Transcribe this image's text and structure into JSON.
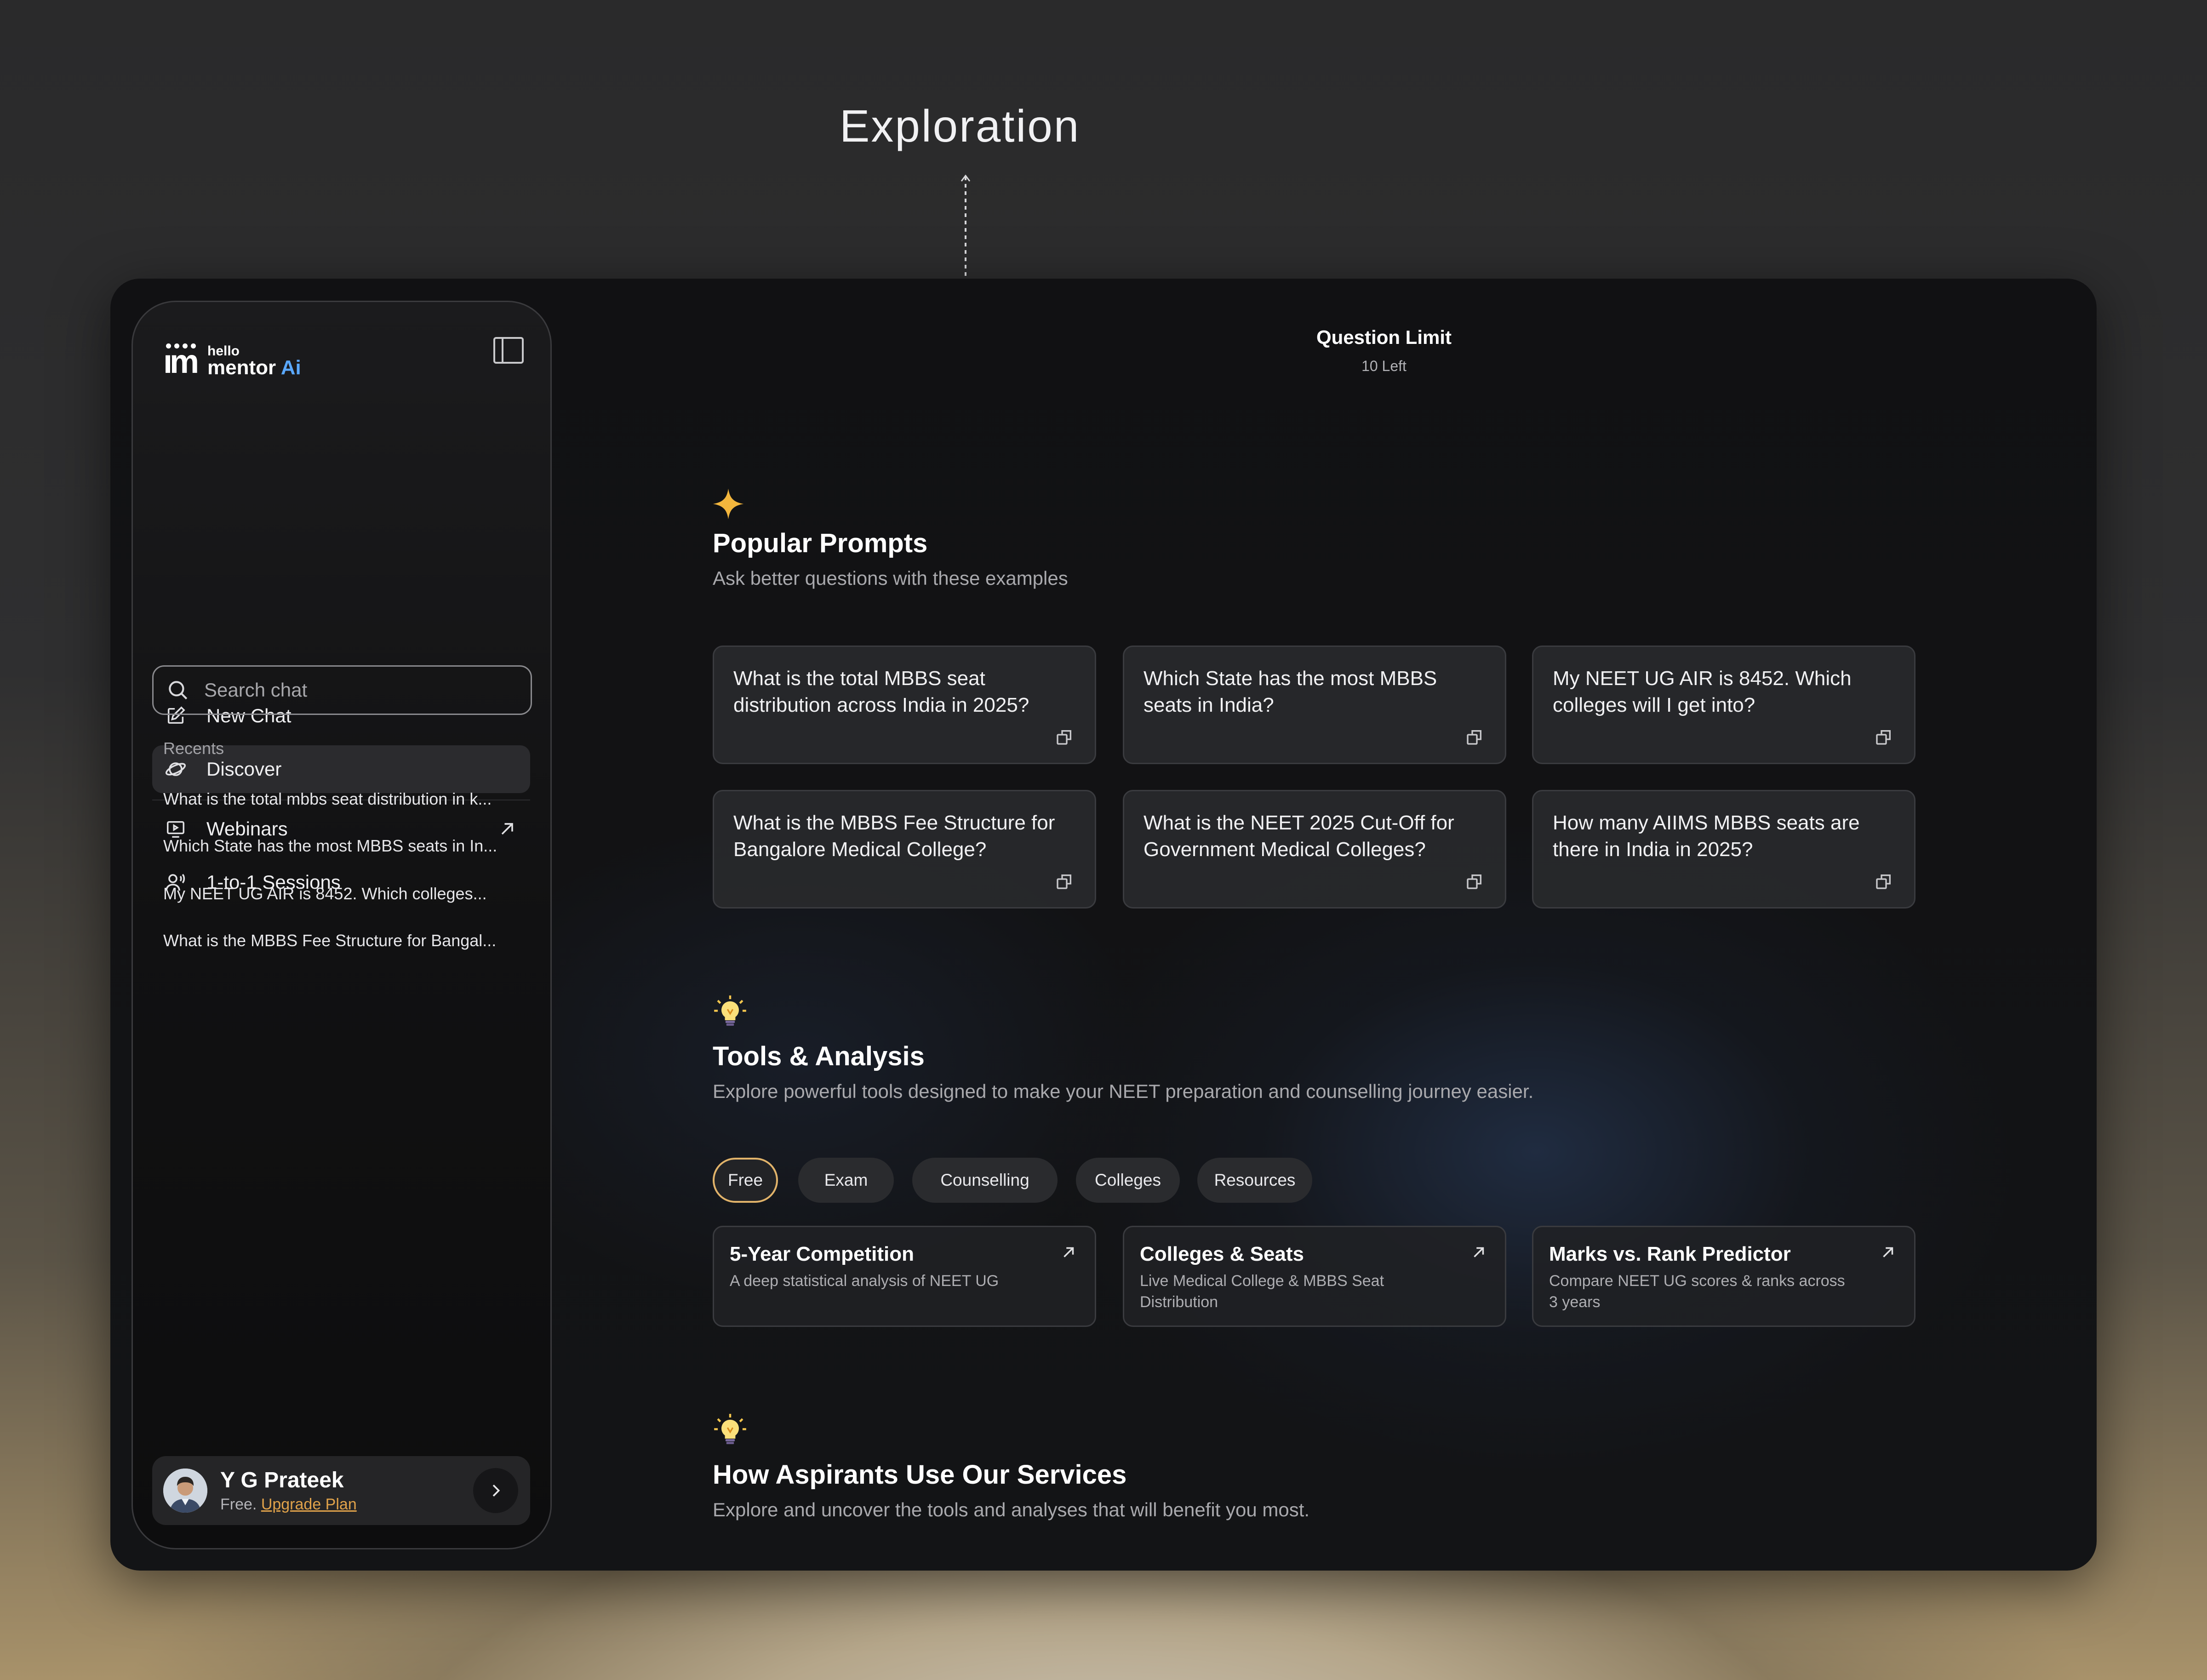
{
  "annotation": {
    "title": "Exploration"
  },
  "sidebar": {
    "logo": {
      "hello": "hello",
      "mentor": "mentor",
      "ai": "Ai"
    },
    "nav": [
      {
        "label": "New Chat",
        "icon": "edit-icon"
      },
      {
        "label": "Discover",
        "icon": "planet-icon",
        "active": true
      },
      {
        "label": "Webinars",
        "icon": "video-icon",
        "external": true
      },
      {
        "label": "1-to-1 Sessions",
        "icon": "voice-user-icon"
      }
    ],
    "search": {
      "placeholder": "Search chat"
    },
    "recents_label": "Recents",
    "recents": [
      "What is the total mbbs seat distribution in k...",
      "Which State has the most MBBS seats in In...",
      "My NEET UG AIR is 8452. Which colleges...",
      "What is the MBBS Fee Structure for Bangal..."
    ],
    "user": {
      "name": "Y G Prateek",
      "plan": "Free.",
      "upgrade": "Upgrade Plan"
    }
  },
  "main": {
    "question_limit": {
      "title": "Question Limit",
      "count": "10 Left"
    },
    "popular": {
      "title": "Popular Prompts",
      "subtitle": "Ask better questions with these examples",
      "prompts": [
        "What is the total MBBS seat distribution across India in 2025?",
        "Which State has the most MBBS seats in India?",
        "My NEET UG AIR is 8452. Which colleges will I get into?",
        "What is the MBBS Fee Structure for Bangalore Medical College?",
        "What is the NEET 2025 Cut-Off for Government Medical Colleges?",
        "How many AIIMS MBBS seats are there in India in 2025?"
      ]
    },
    "tools": {
      "title": "Tools & Analysis",
      "subtitle": "Explore powerful tools designed to make your NEET preparation and counselling journey easier.",
      "chips": [
        "Free",
        "Exam",
        "Counselling",
        "Colleges",
        "Resources"
      ],
      "active_chip": "Free",
      "cards": [
        {
          "title": "5-Year Competition",
          "desc": "A deep statistical analysis of NEET UG"
        },
        {
          "title": "Colleges & Seats",
          "desc": "Live Medical College & MBBS Seat Distribution"
        },
        {
          "title": "Marks vs. Rank Predictor",
          "desc": "Compare NEET UG scores & ranks across 3 years"
        }
      ]
    },
    "services": {
      "title": "How Aspirants Use Our Services",
      "subtitle": "Explore and uncover the tools and analyses that will benefit you most."
    }
  },
  "colors": {
    "accent_gold": "#e1b36a",
    "link_orange": "#e0a24a",
    "logo_blue": "#5aa8ff"
  }
}
